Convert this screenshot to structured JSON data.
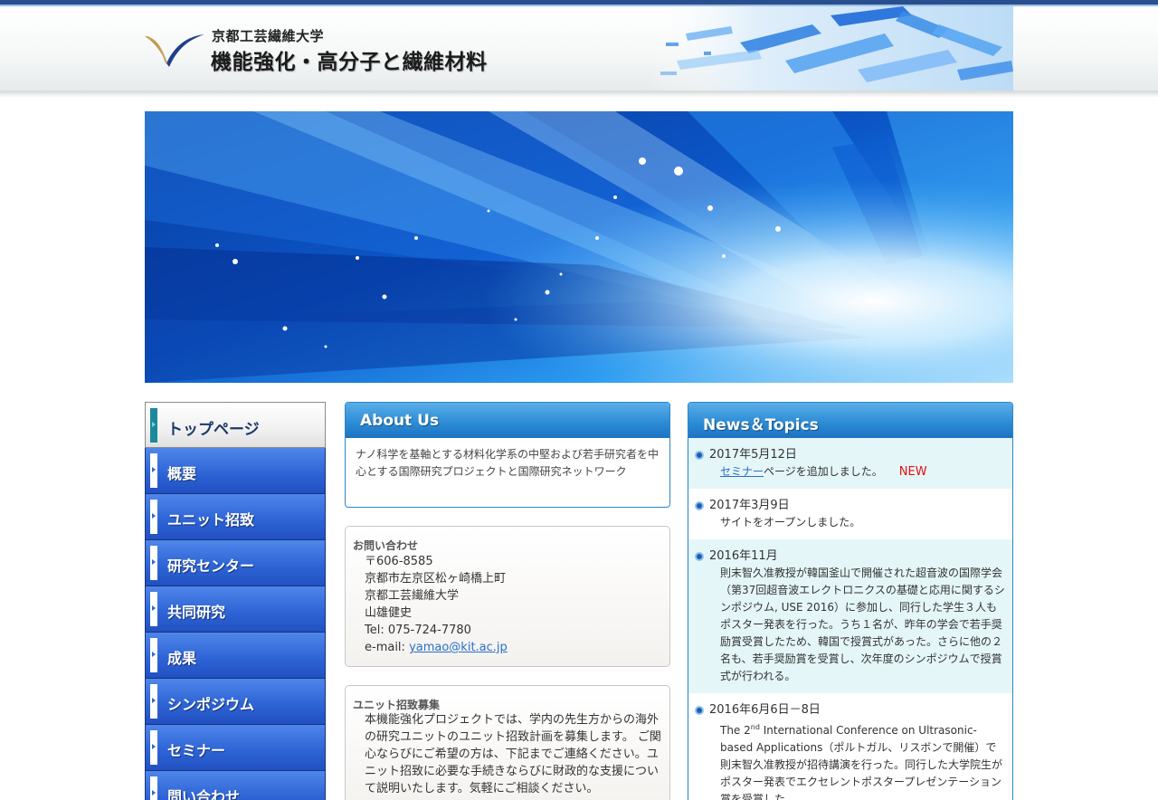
{
  "header": {
    "university": "京都工芸繊維大学",
    "site_title": "機能強化・高分子と繊維材料"
  },
  "nav": {
    "items": [
      {
        "label": "トップページ",
        "active": true
      },
      {
        "label": "概要"
      },
      {
        "label": "ユニット招致"
      },
      {
        "label": "研究センター"
      },
      {
        "label": "共同研究"
      },
      {
        "label": "成果"
      },
      {
        "label": "シンポジウム"
      },
      {
        "label": "セミナー"
      },
      {
        "label": "問い合わせ"
      }
    ]
  },
  "about": {
    "title": "About Us",
    "text": "ナノ科学を基軸とする材料化学系の中堅および若手研究者を中心とする国際研究プロジェクトと国際研究ネットワーク"
  },
  "contact": {
    "title": "お問い合わせ",
    "postal": "〒606-8585",
    "address": "京都市左京区松ヶ崎橋上町",
    "university": "京都工芸繊維大学",
    "person": "山雄健史",
    "tel": "Tel: 075-724-7780",
    "email_label": "e-mail: ",
    "email": "yamao@kit.ac.jp"
  },
  "recruit": {
    "title": "ユニット招致募集",
    "text": "本機能強化プロジェクトでは、学内の先生方からの海外の研究ユニットのユニット招致計画を募集します。 ご関心ならびにご希望の方は、下記までご連絡ください。ユニット招致に必要な手続きならびに財政的な支援について説明いたします。気軽にご相談ください。"
  },
  "news": {
    "title": "News＆Topics",
    "items": [
      {
        "date": "2017年5月12日",
        "link": "セミナー",
        "body": "ページを追加しました。",
        "badge": "NEW"
      },
      {
        "date": "2017年3月9日",
        "body": "サイトをオープンしました。"
      },
      {
        "date": "2016年11月",
        "body": "則末智久准教授が韓国釜山で開催された超音波の国際学会（第37回超音波エレクトロニクスの基礎と応用に関するシンポジウム, USE 2016）に参加し、同行した学生３人もポスター発表を行った。うち１名が、昨年の学会で若手奨励賞受賞したため、韓国で授賞式があった。さらに他の２名も、若手奨励賞を受賞し、次年度のシンポジウムで授賞式が行われる。"
      },
      {
        "date": "2016年6月6日－8日",
        "body_pre": "The 2",
        "body_sup": "nd",
        "body": " International Conference on Ultrasonic-based Applications（ポルトガル、リスボンで開催）で則末智久准教授が招待講演を行った。同行した大学院生がポスター発表でエクセレントポスタープレゼンテーション賞を受賞した。"
      }
    ]
  },
  "colors": {
    "nav_blue": "#2f65d6",
    "panel_blue": "#2a8ad4",
    "news_alt_bg": "#e4f6f8",
    "new_badge": "#e01010",
    "link": "#2a6fc9"
  }
}
